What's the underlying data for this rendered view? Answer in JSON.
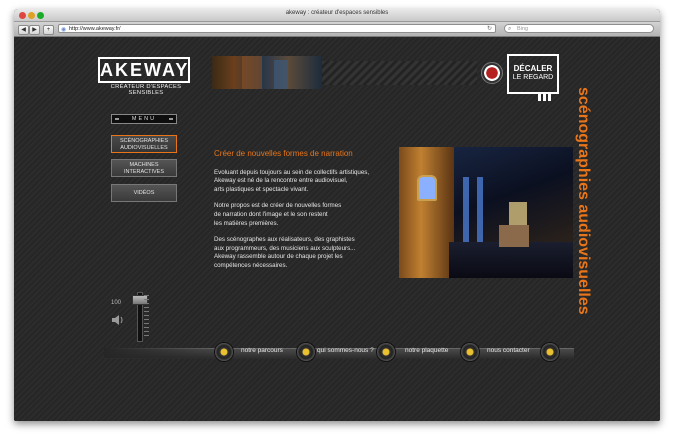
{
  "browser": {
    "title": "akeway : créateur d'espaces sensibles",
    "url": "http://www.akeway.fr/",
    "search_placeholder": "Bing",
    "back_icon": "chevron-left-icon",
    "forward_icon": "chevron-right-icon",
    "add_icon": "plus-icon",
    "reload_icon": "reload-icon"
  },
  "header": {
    "logo": "AKEWAY",
    "tagline": "CRÉATEUR D'ESPACES SENSIBLES",
    "decaler_line1": "DÉCALER",
    "decaler_line2": "LE REGARD"
  },
  "menu": {
    "label": "MENU",
    "items": [
      {
        "line1": "SCÉNOGRAPHIES",
        "line2": "AUDIOVISUELLES",
        "active": true
      },
      {
        "line1": "MACHINES",
        "line2": "INTERACTIVES",
        "active": false
      },
      {
        "line1": "VIDÉOS",
        "line2": "",
        "active": false
      }
    ]
  },
  "section_title": "scénographies audiovisuelles",
  "main": {
    "heading": "Créer de nouvelles formes de narration",
    "p1": [
      "Evoluant depuis toujours au sein de collectifs artistiques,",
      "Akeway est né de la rencontre entre audiovisuel,",
      "arts plastiques et spectacle vivant."
    ],
    "p2": [
      "Notre propos est de créer de nouvelles formes",
      "de narration dont l'image et le son restent",
      "les matières premières."
    ],
    "p3": [
      "Des scénographes aux réalisateurs, des graphistes",
      "aux programmeurs, des musiciens aux sculpteurs...",
      "Akeway rassemble autour de chaque projet les",
      "compétences nécessaires."
    ]
  },
  "volume": {
    "value_label": "100",
    "level": 100
  },
  "footer_nav": [
    {
      "label": "notre parcours"
    },
    {
      "label": "qui sommes-nous ?"
    },
    {
      "label": "notre plaquette"
    },
    {
      "label": "nous contacter"
    }
  ],
  "colors": {
    "accent": "#e8751a",
    "background": "#2a2a2a",
    "text": "#e6e6e6"
  }
}
